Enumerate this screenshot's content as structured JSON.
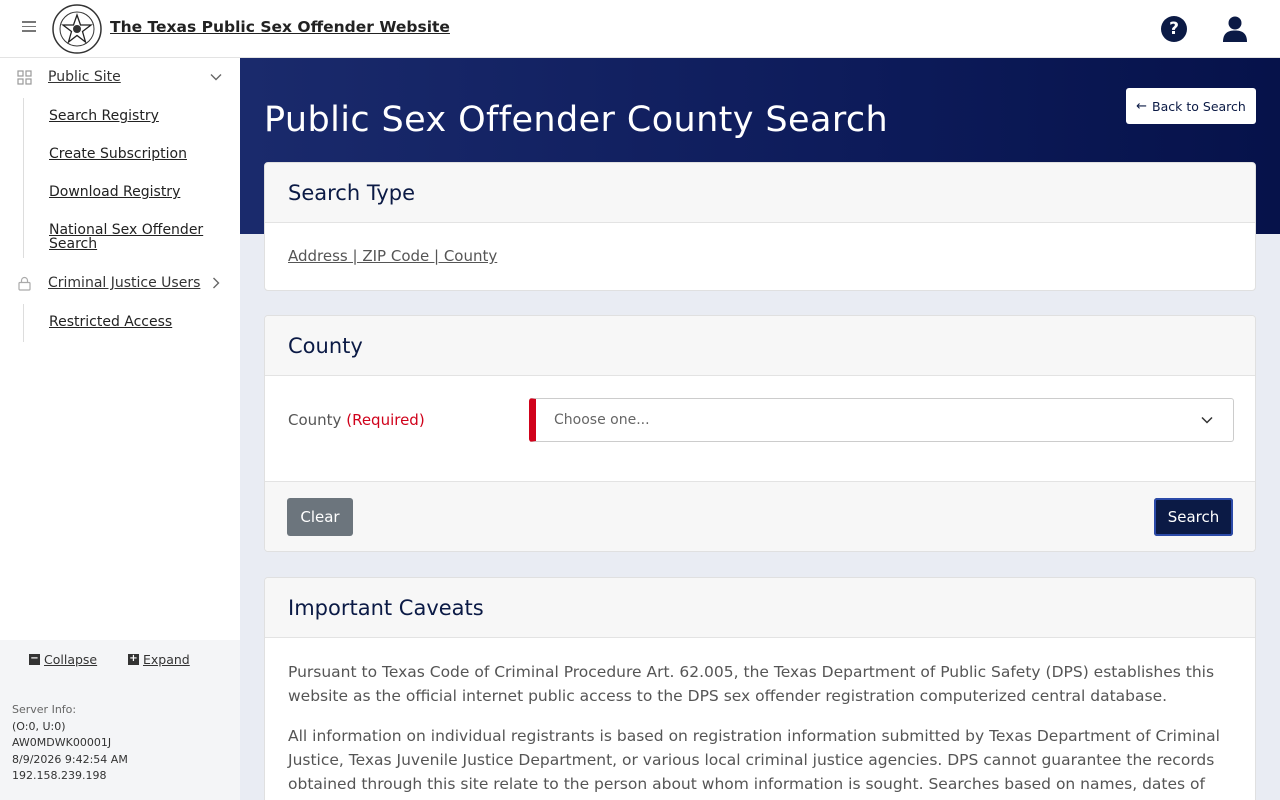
{
  "header": {
    "site_title": "The Texas Public Sex Offender Website",
    "help_icon": "question-circle-icon",
    "user_icon": "user-icon"
  },
  "sidebar": {
    "groups": [
      {
        "label": "Public Site",
        "icon": "grid-icon",
        "expanded": true,
        "items": [
          "Search Registry",
          "Create Subscription",
          "Download Registry",
          "National Sex Offender Search"
        ]
      },
      {
        "label": "Criminal Justice Users",
        "icon": "lock-icon",
        "expanded": false,
        "items": [
          "Restricted Access"
        ]
      }
    ],
    "collapse_label": "Collapse",
    "expand_label": "Expand",
    "server_info": {
      "label": "Server Info:",
      "line1": "(O:0, U:0)",
      "line2": "AW0MDWK00001J",
      "line3": "8/9/2026 9:42:54 AM",
      "line4": "192.158.239.198"
    }
  },
  "main": {
    "page_title": "Public Sex Offender County Search",
    "back_button": "Back to Search",
    "search_type": {
      "heading": "Search Type",
      "links": "Address | ZIP Code | County"
    },
    "county": {
      "heading": "County",
      "label": "County",
      "required": "(Required)",
      "select_placeholder": "Choose one...",
      "clear_button": "Clear",
      "search_button": "Search"
    },
    "caveats": {
      "heading": "Important Caveats",
      "p1": "Pursuant to Texas Code of Criminal Procedure Art. 62.005, the Texas Department of Public Safety (DPS) establishes this website as the official internet public access to the DPS sex offender registration computerized central database.",
      "p2": "All information on individual registrants is based on registration information submitted by Texas Department of Criminal Justice, Texas Juvenile Justice Department, or various local criminal justice agencies. DPS cannot guarantee the records obtained through this site relate to the person about whom information is sought. Searches based on names, dates of"
    }
  },
  "colors": {
    "navy": "#0b1a45",
    "required_red": "#d0021b",
    "clear_gray": "#6c757d"
  }
}
